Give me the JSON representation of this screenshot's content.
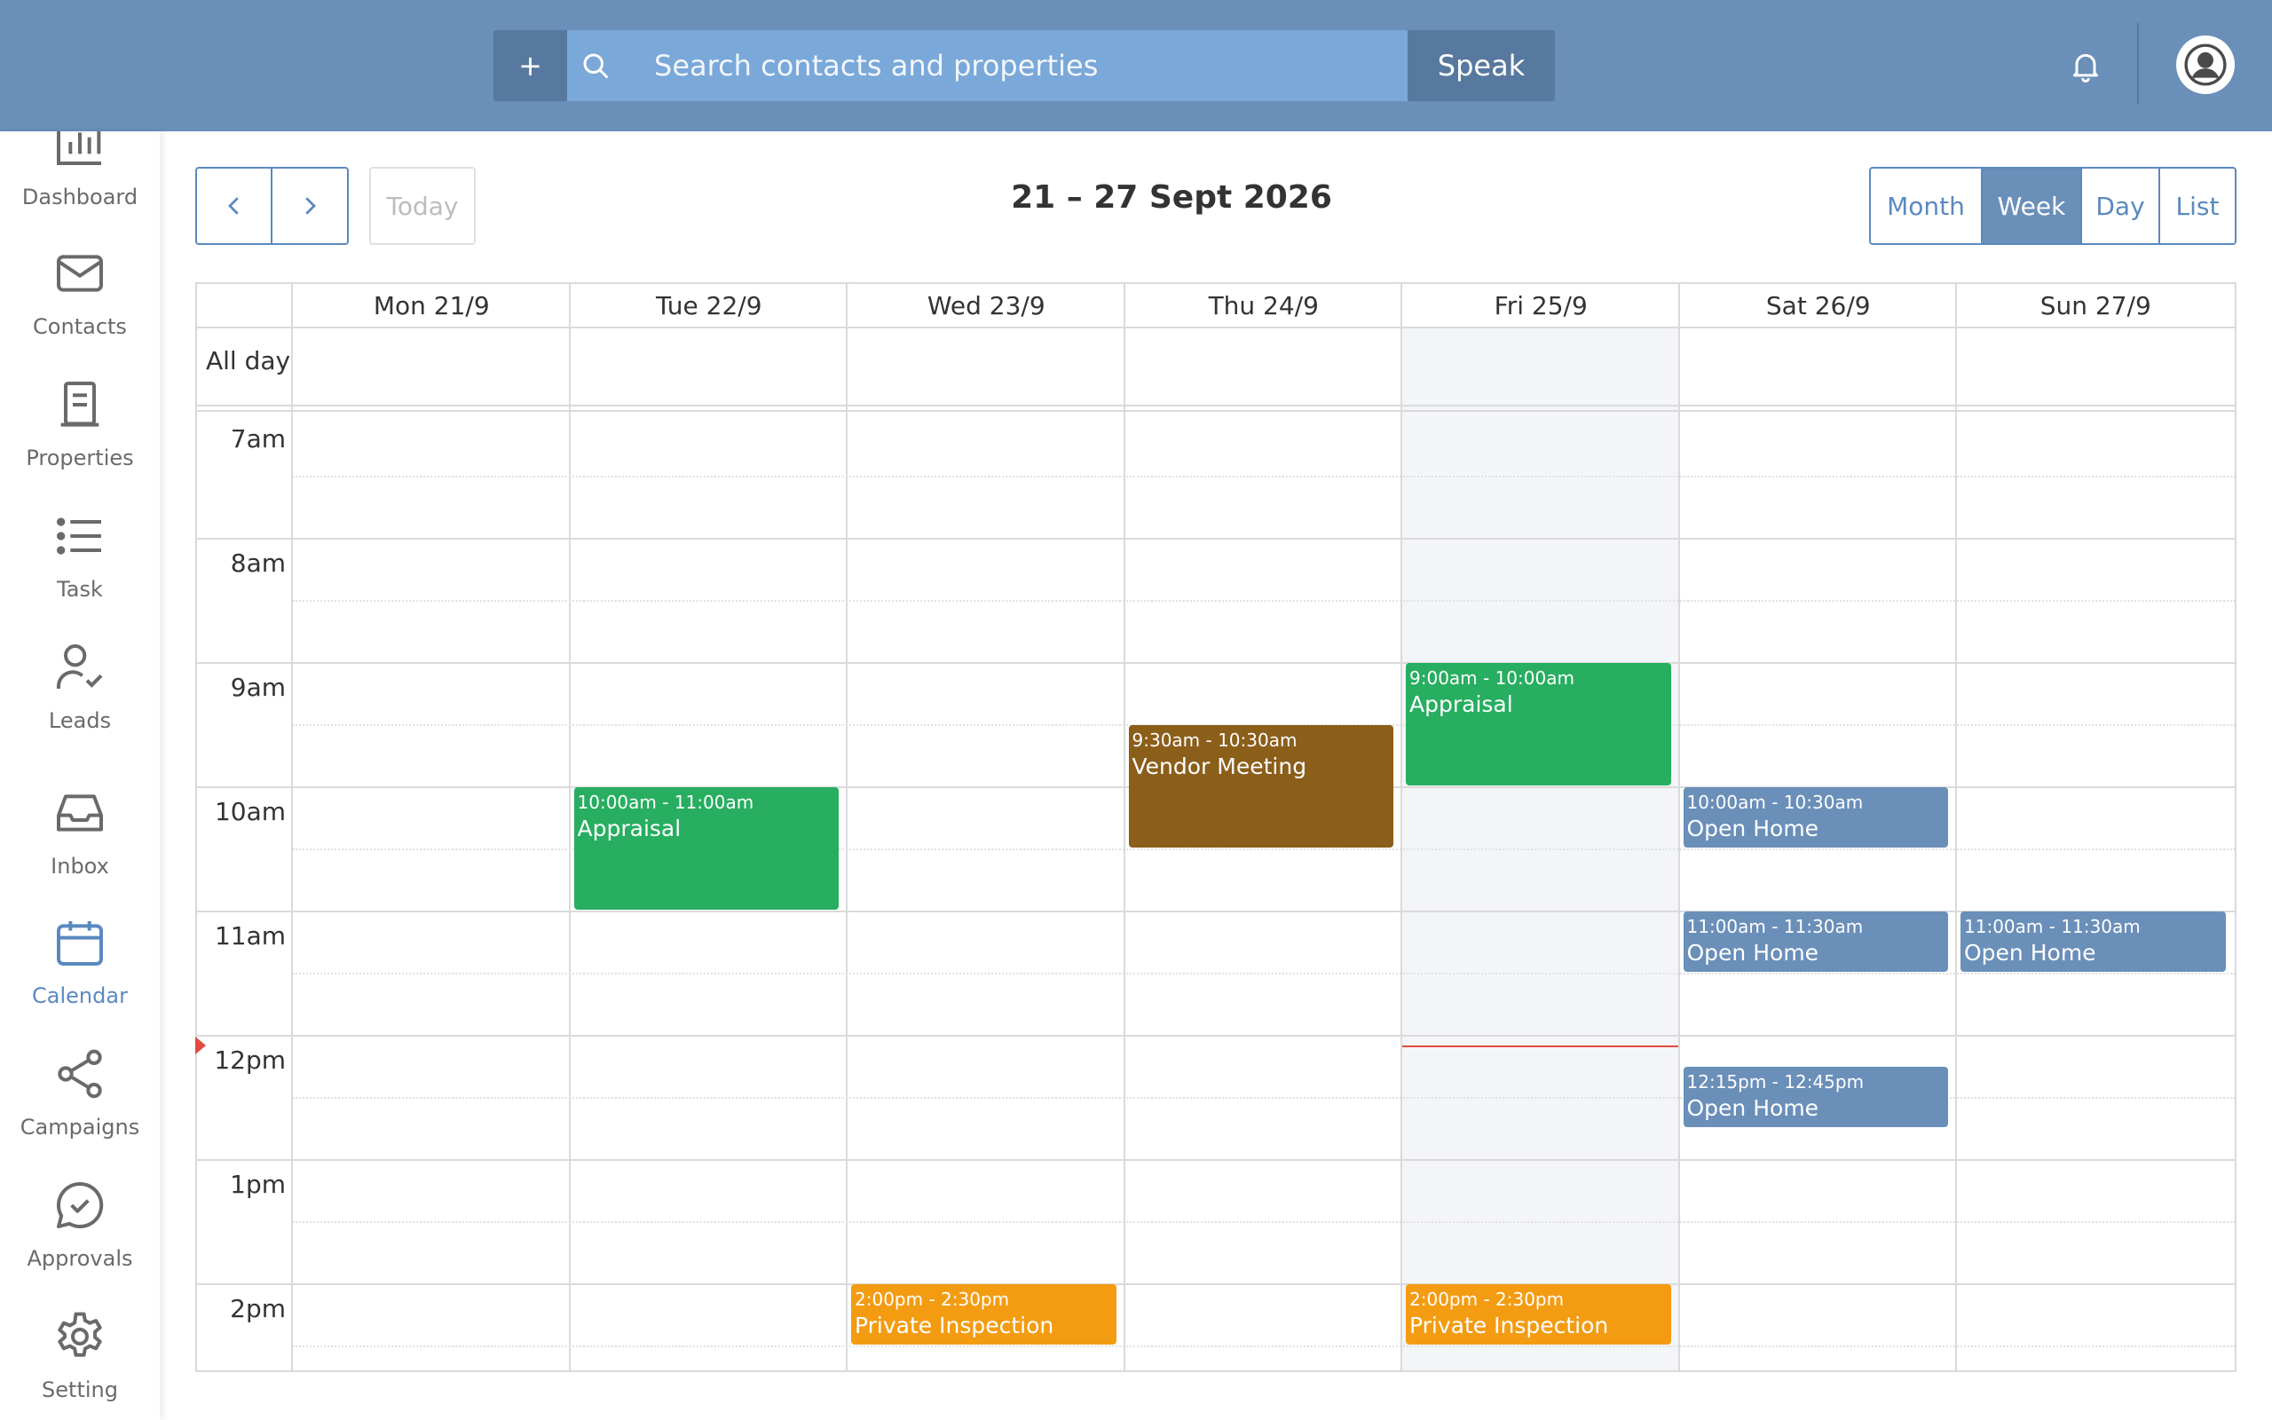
{
  "header": {
    "add_label": "+",
    "search_placeholder": "Search contacts and properties",
    "speak_label": "Speak"
  },
  "sidebar": {
    "items": [
      {
        "label": "Dashboard",
        "icon": "bar-chart-icon"
      },
      {
        "label": "Contacts",
        "icon": "envelope-icon"
      },
      {
        "label": "Properties",
        "icon": "building-icon"
      },
      {
        "label": "Task",
        "icon": "list-icon"
      },
      {
        "label": "Leads",
        "icon": "user-check-icon"
      },
      {
        "label": "Inbox",
        "icon": "inbox-icon"
      },
      {
        "label": "Calendar",
        "icon": "calendar-icon",
        "active": true
      },
      {
        "label": "Campaigns",
        "icon": "share-icon"
      },
      {
        "label": "Approvals",
        "icon": "chat-check-icon"
      },
      {
        "label": "Setting",
        "icon": "gear-icon"
      }
    ]
  },
  "toolbar": {
    "today_label": "Today",
    "range_title": "21 – 27 Sept 2026",
    "views": [
      "Month",
      "Week",
      "Day",
      "List"
    ],
    "active_view": "Week"
  },
  "calendar": {
    "days": [
      "Mon 21/9",
      "Tue 22/9",
      "Wed 23/9",
      "Thu 24/9",
      "Fri 25/9",
      "Sat 26/9",
      "Sun 27/9"
    ],
    "today_index": 4,
    "all_day_label": "All day",
    "hours": [
      "7am",
      "8am",
      "9am",
      "10am",
      "11am",
      "12pm",
      "1pm",
      "2pm"
    ],
    "now_time": "12:05pm",
    "events": [
      {
        "day": 1,
        "start": "10:00",
        "end": "11:00",
        "time": "10:00am - 11:00am",
        "title": "Appraisal",
        "color": "#27ae60"
      },
      {
        "day": 3,
        "start": "09:30",
        "end": "10:30",
        "time": "9:30am - 10:30am",
        "title": "Vendor Meeting",
        "color": "#8b5e1a"
      },
      {
        "day": 4,
        "start": "09:00",
        "end": "10:00",
        "time": "9:00am - 10:00am",
        "title": "Appraisal",
        "color": "#27ae60"
      },
      {
        "day": 5,
        "start": "10:00",
        "end": "10:30",
        "time": "10:00am - 10:30am",
        "title": "Open Home",
        "color": "#6a8fb9"
      },
      {
        "day": 5,
        "start": "11:00",
        "end": "11:30",
        "time": "11:00am - 11:30am",
        "title": "Open Home",
        "color": "#6a8fb9"
      },
      {
        "day": 6,
        "start": "11:00",
        "end": "11:30",
        "time": "11:00am - 11:30am",
        "title": "Open Home",
        "color": "#6a8fb9"
      },
      {
        "day": 5,
        "start": "12:15",
        "end": "12:45",
        "time": "12:15pm - 12:45pm",
        "title": "Open Home",
        "color": "#6a8fb9"
      },
      {
        "day": 2,
        "start": "14:00",
        "end": "14:30",
        "time": "2:00pm - 2:30pm",
        "title": "Private Inspection",
        "color": "#f39c12"
      },
      {
        "day": 4,
        "start": "14:00",
        "end": "14:30",
        "time": "2:00pm - 2:30pm",
        "title": "Private Inspection",
        "color": "#f39c12"
      }
    ]
  }
}
